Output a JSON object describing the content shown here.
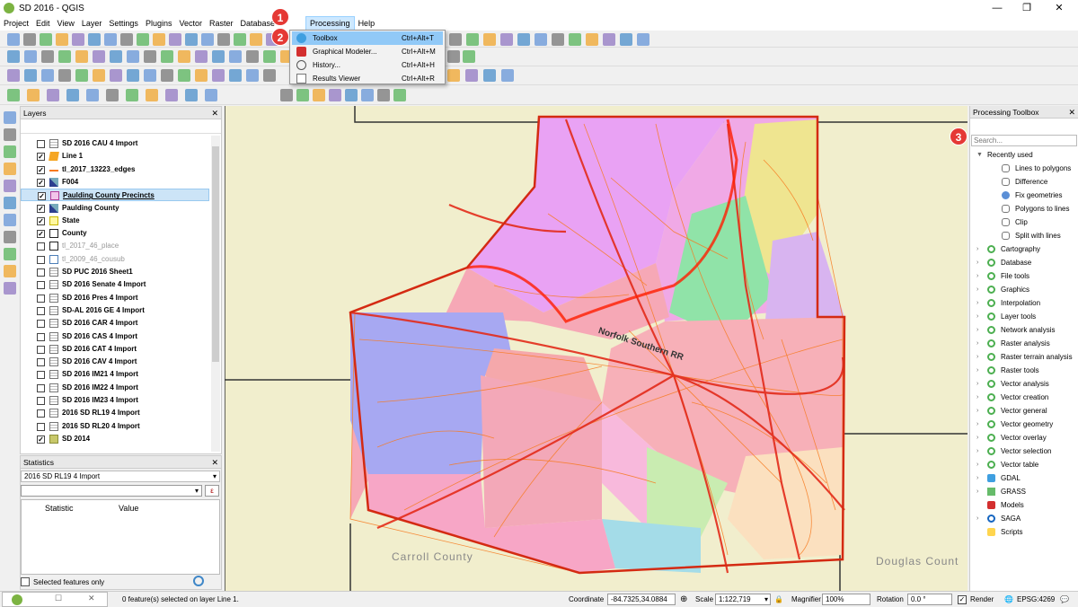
{
  "window": {
    "title": "SD 2016 - QGIS",
    "min": "—",
    "max": "❐",
    "close": "✕"
  },
  "menu": [
    "Project",
    "Edit",
    "View",
    "Layer",
    "Settings",
    "Plugins",
    "Vector",
    "Raster",
    "Database",
    "Processing",
    "Help"
  ],
  "dropdown": [
    {
      "label": "Toolbox",
      "shortcut": "Ctrl+Alt+T",
      "icon": "gear-icon"
    },
    {
      "label": "Graphical Modeler...",
      "shortcut": "Ctrl+Alt+M",
      "icon": "modeler-icon"
    },
    {
      "label": "History...",
      "shortcut": "Ctrl+Alt+H",
      "icon": "history-icon"
    },
    {
      "label": "Results Viewer",
      "shortcut": "Ctrl+Alt+R",
      "icon": "results-icon"
    }
  ],
  "badges": [
    "1",
    "2",
    "3"
  ],
  "layers_panel": {
    "title": "Layers",
    "close": "✕",
    "float": "⧉",
    "items": [
      {
        "name": "SD 2016 CAU 4 Import",
        "checked": false,
        "icon": "table",
        "dim": false
      },
      {
        "name": "Line 1",
        "checked": true,
        "icon": "line",
        "dim": false
      },
      {
        "name": "tl_2017_13223_edges",
        "checked": true,
        "icon": "line-orange",
        "dim": false
      },
      {
        "name": "F004",
        "checked": true,
        "icon": "raster",
        "dim": false
      },
      {
        "name": "Paulding County Precincts",
        "checked": true,
        "icon": "polygon-pink",
        "dim": false,
        "selected": true
      },
      {
        "name": "Paulding County",
        "checked": true,
        "icon": "raster",
        "dim": false
      },
      {
        "name": "State",
        "checked": true,
        "icon": "polygon-yellow",
        "dim": false
      },
      {
        "name": "County",
        "checked": true,
        "icon": "polygon-black",
        "dim": false
      },
      {
        "name": "tl_2017_46_place",
        "checked": false,
        "icon": "polygon-black",
        "dim": true
      },
      {
        "name": "tl_2009_46_cousub",
        "checked": false,
        "icon": "polygon-blue",
        "dim": true
      },
      {
        "name": "SD PUC 2016 Sheet1",
        "checked": false,
        "icon": "table",
        "dim": false
      },
      {
        "name": "SD 2016 Senate 4 Import",
        "checked": false,
        "icon": "table",
        "dim": false
      },
      {
        "name": "SD 2016 Pres 4 Import",
        "checked": false,
        "icon": "table",
        "dim": false
      },
      {
        "name": "SD-AL 2016 GE 4 Import",
        "checked": false,
        "icon": "table",
        "dim": false
      },
      {
        "name": "SD 2016 CAR 4 Import",
        "checked": false,
        "icon": "table",
        "dim": false
      },
      {
        "name": "SD 2016 CAS 4 Import",
        "checked": false,
        "icon": "table",
        "dim": false
      },
      {
        "name": "SD 2016 CAT 4 Import",
        "checked": false,
        "icon": "table",
        "dim": false
      },
      {
        "name": "SD 2016 CAV 4 Import",
        "checked": false,
        "icon": "table",
        "dim": false
      },
      {
        "name": "SD 2016 IM21 4 Import",
        "checked": false,
        "icon": "table",
        "dim": false
      },
      {
        "name": "SD 2016 IM22 4 Import",
        "checked": false,
        "icon": "table",
        "dim": false
      },
      {
        "name": "SD 2016 IM23 4 Import",
        "checked": false,
        "icon": "table",
        "dim": false
      },
      {
        "name": "2016 SD RL19 4 Import",
        "checked": false,
        "icon": "table",
        "dim": false
      },
      {
        "name": "2016 SD RL20 4 Import",
        "checked": false,
        "icon": "table",
        "dim": false
      },
      {
        "name": "SD 2014",
        "checked": true,
        "icon": "polygon-olive",
        "dim": false
      }
    ]
  },
  "stats_panel": {
    "title": "Statistics",
    "layer": "2016 SD RL19 4 Import",
    "col_statistic": "Statistic",
    "col_value": "Value",
    "selected_only": "Selected features only",
    "epsilon": "ε"
  },
  "map": {
    "labels": [
      "Carroll County",
      "Douglas Count",
      "Norfolk Southern RR"
    ]
  },
  "toolbox": {
    "title": "Processing Toolbox",
    "search_placeholder": "Search...",
    "recent_label": "Recently used",
    "recent": [
      "Lines to polygons",
      "Difference",
      "Fix geometries",
      "Polygons to lines",
      "Clip",
      "Split with lines"
    ],
    "groups": [
      "Cartography",
      "Database",
      "File tools",
      "Graphics",
      "Interpolation",
      "Layer tools",
      "Network analysis",
      "Raster analysis",
      "Raster terrain analysis",
      "Raster tools",
      "Vector analysis",
      "Vector creation",
      "Vector general",
      "Vector geometry",
      "Vector overlay",
      "Vector selection",
      "Vector table",
      "GDAL",
      "GRASS",
      "Models",
      "SAGA",
      "Scripts"
    ]
  },
  "status": {
    "selected": "0 feature(s) selected on layer Line 1.",
    "coord_label": "Coordinate",
    "coord": "-84.7325,34.0884",
    "scale_label": "Scale",
    "scale": "1:122,719",
    "mag_label": "Magnifier",
    "mag": "100%",
    "rot_label": "Rotation",
    "rot": "0.0 °",
    "render": "Render",
    "crs": "EPSG:4269"
  },
  "colors": {
    "accent": "#91c9f7",
    "badge": "#e53935",
    "map_bg": "#f1eecd"
  }
}
